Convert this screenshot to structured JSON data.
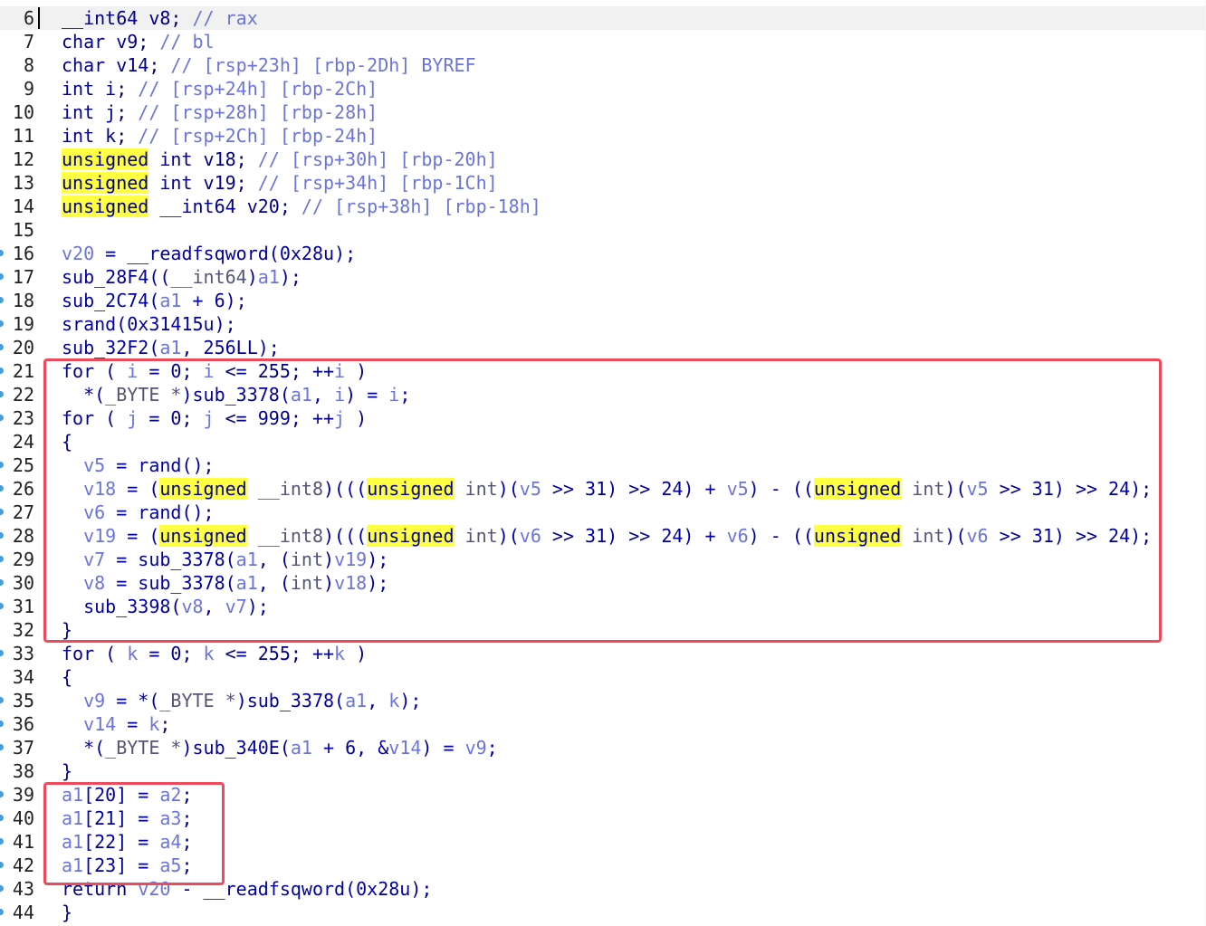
{
  "colors": {
    "keyword": "#000088",
    "identifier": "#0000a0",
    "variable": "#6b74d9",
    "comment": "#6b74d9",
    "highlight": "#ffff44",
    "annotation_box": "#ee4a5c",
    "breakpoint_dot": "#4a9bd9"
  },
  "lines": [
    {
      "num": "6",
      "bp": false,
      "current": true,
      "tokens": [
        [
          "kw",
          "__int64 v8; "
        ],
        [
          "cm",
          "// rax"
        ]
      ]
    },
    {
      "num": "7",
      "bp": false,
      "tokens": [
        [
          "kw",
          "char v9; "
        ],
        [
          "cm",
          "// bl"
        ]
      ]
    },
    {
      "num": "8",
      "bp": false,
      "tokens": [
        [
          "kw",
          "char v14; "
        ],
        [
          "cm",
          "// [rsp+23h] [rbp-2Dh] BYREF"
        ]
      ]
    },
    {
      "num": "9",
      "bp": false,
      "tokens": [
        [
          "kw",
          "int i; "
        ],
        [
          "cm",
          "// [rsp+24h] [rbp-2Ch]"
        ]
      ]
    },
    {
      "num": "10",
      "bp": false,
      "tokens": [
        [
          "kw",
          "int j; "
        ],
        [
          "cm",
          "// [rsp+28h] [rbp-28h]"
        ]
      ]
    },
    {
      "num": "11",
      "bp": false,
      "tokens": [
        [
          "kw",
          "int k; "
        ],
        [
          "cm",
          "// [rsp+2Ch] [rbp-24h]"
        ]
      ]
    },
    {
      "num": "12",
      "bp": false,
      "tokens": [
        [
          "hl",
          "unsigned"
        ],
        [
          "kw",
          " int v18; "
        ],
        [
          "cm",
          "// [rsp+30h] [rbp-20h]"
        ]
      ]
    },
    {
      "num": "13",
      "bp": false,
      "tokens": [
        [
          "hl",
          "unsigned"
        ],
        [
          "kw",
          " int v19; "
        ],
        [
          "cm",
          "// [rsp+34h] [rbp-1Ch]"
        ]
      ]
    },
    {
      "num": "14",
      "bp": false,
      "tokens": [
        [
          "hl",
          "unsigned"
        ],
        [
          "kw",
          " __int64 v20; "
        ],
        [
          "cm",
          "// [rsp+38h] [rbp-18h]"
        ]
      ]
    },
    {
      "num": "15",
      "bp": false,
      "tokens": []
    },
    {
      "num": "16",
      "bp": true,
      "tokens": [
        [
          "var",
          "v20"
        ],
        [
          "op",
          " = "
        ],
        [
          "id",
          "__readfsqword(0x28u);"
        ]
      ]
    },
    {
      "num": "17",
      "bp": true,
      "tokens": [
        [
          "id",
          "sub_28F4(("
        ],
        [
          "gray",
          "__int64"
        ],
        [
          "id",
          ")"
        ],
        [
          "var",
          "a1"
        ],
        [
          "id",
          ");"
        ]
      ]
    },
    {
      "num": "18",
      "bp": true,
      "tokens": [
        [
          "id",
          "sub_2C74("
        ],
        [
          "var",
          "a1"
        ],
        [
          "id",
          " + 6);"
        ]
      ]
    },
    {
      "num": "19",
      "bp": true,
      "tokens": [
        [
          "id",
          "srand(0x31415u);"
        ]
      ]
    },
    {
      "num": "20",
      "bp": true,
      "tokens": [
        [
          "id",
          "sub_32F2("
        ],
        [
          "var",
          "a1"
        ],
        [
          "id",
          ", 256LL);"
        ]
      ]
    },
    {
      "num": "21",
      "bp": true,
      "tokens": [
        [
          "kw",
          "for ( "
        ],
        [
          "var",
          "i"
        ],
        [
          "kw",
          " = 0; "
        ],
        [
          "var",
          "i"
        ],
        [
          "kw",
          " <= 255; ++"
        ],
        [
          "var",
          "i"
        ],
        [
          "kw",
          " )"
        ]
      ]
    },
    {
      "num": "22",
      "bp": true,
      "tokens": [
        [
          "id",
          "  *("
        ],
        [
          "gray",
          "_BYTE *"
        ],
        [
          "id",
          ")sub_3378("
        ],
        [
          "var",
          "a1"
        ],
        [
          "id",
          ", "
        ],
        [
          "var",
          "i"
        ],
        [
          "id",
          ") = "
        ],
        [
          "var",
          "i"
        ],
        [
          "id",
          ";"
        ]
      ]
    },
    {
      "num": "23",
      "bp": true,
      "tokens": [
        [
          "kw",
          "for ( "
        ],
        [
          "var",
          "j"
        ],
        [
          "kw",
          " = 0; "
        ],
        [
          "var",
          "j"
        ],
        [
          "kw",
          " <= 999; ++"
        ],
        [
          "var",
          "j"
        ],
        [
          "kw",
          " )"
        ]
      ]
    },
    {
      "num": "24",
      "bp": false,
      "tokens": [
        [
          "kw",
          "{"
        ]
      ]
    },
    {
      "num": "25",
      "bp": true,
      "tokens": [
        [
          "var",
          "  v5"
        ],
        [
          "id",
          " = rand();"
        ]
      ]
    },
    {
      "num": "26",
      "bp": true,
      "tokens": [
        [
          "var",
          "  v18"
        ],
        [
          "id",
          " = ("
        ],
        [
          "hl",
          "unsigned"
        ],
        [
          "gray",
          " __int8"
        ],
        [
          "id",
          ")((("
        ],
        [
          "hl",
          "unsigned"
        ],
        [
          "gray",
          " int"
        ],
        [
          "id",
          ")("
        ],
        [
          "var",
          "v5"
        ],
        [
          "id",
          " >> 31) >> 24) + "
        ],
        [
          "var",
          "v5"
        ],
        [
          "id",
          ") - (("
        ],
        [
          "hl",
          "unsigned"
        ],
        [
          "gray",
          " int"
        ],
        [
          "id",
          ")("
        ],
        [
          "var",
          "v5"
        ],
        [
          "id",
          " >> 31) >> 24);"
        ]
      ]
    },
    {
      "num": "27",
      "bp": true,
      "tokens": [
        [
          "var",
          "  v6"
        ],
        [
          "id",
          " = rand();"
        ]
      ]
    },
    {
      "num": "28",
      "bp": true,
      "tokens": [
        [
          "var",
          "  v19"
        ],
        [
          "id",
          " = ("
        ],
        [
          "hl",
          "unsigned"
        ],
        [
          "gray",
          " __int8"
        ],
        [
          "id",
          ")((("
        ],
        [
          "hl",
          "unsigned"
        ],
        [
          "gray",
          " int"
        ],
        [
          "id",
          ")("
        ],
        [
          "var",
          "v6"
        ],
        [
          "id",
          " >> 31) >> 24) + "
        ],
        [
          "var",
          "v6"
        ],
        [
          "id",
          ") - (("
        ],
        [
          "hl",
          "unsigned"
        ],
        [
          "gray",
          " int"
        ],
        [
          "id",
          ")("
        ],
        [
          "var",
          "v6"
        ],
        [
          "id",
          " >> 31) >> 24);"
        ]
      ]
    },
    {
      "num": "29",
      "bp": true,
      "tokens": [
        [
          "var",
          "  v7"
        ],
        [
          "id",
          " = sub_3378("
        ],
        [
          "var",
          "a1"
        ],
        [
          "id",
          ", ("
        ],
        [
          "gray",
          "int"
        ],
        [
          "id",
          ")"
        ],
        [
          "var",
          "v19"
        ],
        [
          "id",
          ");"
        ]
      ]
    },
    {
      "num": "30",
      "bp": true,
      "tokens": [
        [
          "var",
          "  v8"
        ],
        [
          "id",
          " = sub_3378("
        ],
        [
          "var",
          "a1"
        ],
        [
          "id",
          ", ("
        ],
        [
          "gray",
          "int"
        ],
        [
          "id",
          ")"
        ],
        [
          "var",
          "v18"
        ],
        [
          "id",
          ");"
        ]
      ]
    },
    {
      "num": "31",
      "bp": true,
      "tokens": [
        [
          "id",
          "  sub_3398("
        ],
        [
          "var",
          "v8"
        ],
        [
          "id",
          ", "
        ],
        [
          "var",
          "v7"
        ],
        [
          "id",
          ");"
        ]
      ]
    },
    {
      "num": "32",
      "bp": false,
      "tokens": [
        [
          "kw",
          "}"
        ]
      ]
    },
    {
      "num": "33",
      "bp": true,
      "tokens": [
        [
          "kw",
          "for ( "
        ],
        [
          "var",
          "k"
        ],
        [
          "kw",
          " = 0; "
        ],
        [
          "var",
          "k"
        ],
        [
          "kw",
          " <= 255; ++"
        ],
        [
          "var",
          "k"
        ],
        [
          "kw",
          " )"
        ]
      ]
    },
    {
      "num": "34",
      "bp": false,
      "tokens": [
        [
          "kw",
          "{"
        ]
      ]
    },
    {
      "num": "35",
      "bp": true,
      "tokens": [
        [
          "var",
          "  v9"
        ],
        [
          "id",
          " = *("
        ],
        [
          "gray",
          "_BYTE *"
        ],
        [
          "id",
          ")sub_3378("
        ],
        [
          "var",
          "a1"
        ],
        [
          "id",
          ", "
        ],
        [
          "var",
          "k"
        ],
        [
          "id",
          ");"
        ]
      ]
    },
    {
      "num": "36",
      "bp": true,
      "tokens": [
        [
          "var",
          "  v14"
        ],
        [
          "id",
          " = "
        ],
        [
          "var",
          "k"
        ],
        [
          "id",
          ";"
        ]
      ]
    },
    {
      "num": "37",
      "bp": true,
      "tokens": [
        [
          "id",
          "  *("
        ],
        [
          "gray",
          "_BYTE *"
        ],
        [
          "id",
          ")sub_340E("
        ],
        [
          "var",
          "a1"
        ],
        [
          "id",
          " + 6, &"
        ],
        [
          "var",
          "v14"
        ],
        [
          "id",
          ") = "
        ],
        [
          "var",
          "v9"
        ],
        [
          "id",
          ";"
        ]
      ]
    },
    {
      "num": "38",
      "bp": false,
      "tokens": [
        [
          "kw",
          "}"
        ]
      ]
    },
    {
      "num": "39",
      "bp": true,
      "tokens": [
        [
          "var",
          "a1"
        ],
        [
          "id",
          "[20] = "
        ],
        [
          "var",
          "a2"
        ],
        [
          "id",
          ";"
        ]
      ]
    },
    {
      "num": "40",
      "bp": true,
      "tokens": [
        [
          "var",
          "a1"
        ],
        [
          "id",
          "[21] = "
        ],
        [
          "var",
          "a3"
        ],
        [
          "id",
          ";"
        ]
      ]
    },
    {
      "num": "41",
      "bp": true,
      "tokens": [
        [
          "var",
          "a1"
        ],
        [
          "id",
          "[22] = "
        ],
        [
          "var",
          "a4"
        ],
        [
          "id",
          ";"
        ]
      ]
    },
    {
      "num": "42",
      "bp": true,
      "tokens": [
        [
          "var",
          "a1"
        ],
        [
          "id",
          "[23] = "
        ],
        [
          "var",
          "a5"
        ],
        [
          "id",
          ";"
        ]
      ]
    },
    {
      "num": "43",
      "bp": true,
      "tokens": [
        [
          "kw",
          "return "
        ],
        [
          "var",
          "v20"
        ],
        [
          "id",
          " - __readfsqword(0x28u);"
        ]
      ]
    },
    {
      "num": "44",
      "bp": true,
      "tokens": [
        [
          "kw",
          "}"
        ]
      ]
    }
  ]
}
